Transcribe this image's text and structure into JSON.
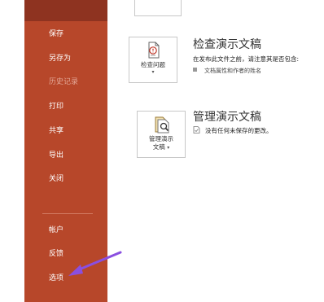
{
  "sidebar": {
    "items": [
      {
        "label": "保存",
        "disabled": false
      },
      {
        "label": "另存为",
        "disabled": false
      },
      {
        "label": "历史记录",
        "disabled": true
      },
      {
        "label": "打印",
        "disabled": false
      },
      {
        "label": "共享",
        "disabled": false
      },
      {
        "label": "导出",
        "disabled": false
      },
      {
        "label": "关闭",
        "disabled": false
      }
    ],
    "bottom_items": [
      {
        "label": "帐户"
      },
      {
        "label": "反馈"
      },
      {
        "label": "选项"
      }
    ]
  },
  "inspect": {
    "button_label": "检查问题",
    "title": "检查演示文稿",
    "description": "在发布此文件之前，请注意其是否包含:",
    "bullet": "文档属性和作者的姓名"
  },
  "manage": {
    "button_label_line1": "管理演示",
    "button_label_line2": "文稿",
    "title": "管理演示文稿",
    "status": "没有任何未保存的更改。"
  },
  "colors": {
    "sidebar": "#b7472a",
    "annotation_arrow": "#8a4fe0"
  }
}
